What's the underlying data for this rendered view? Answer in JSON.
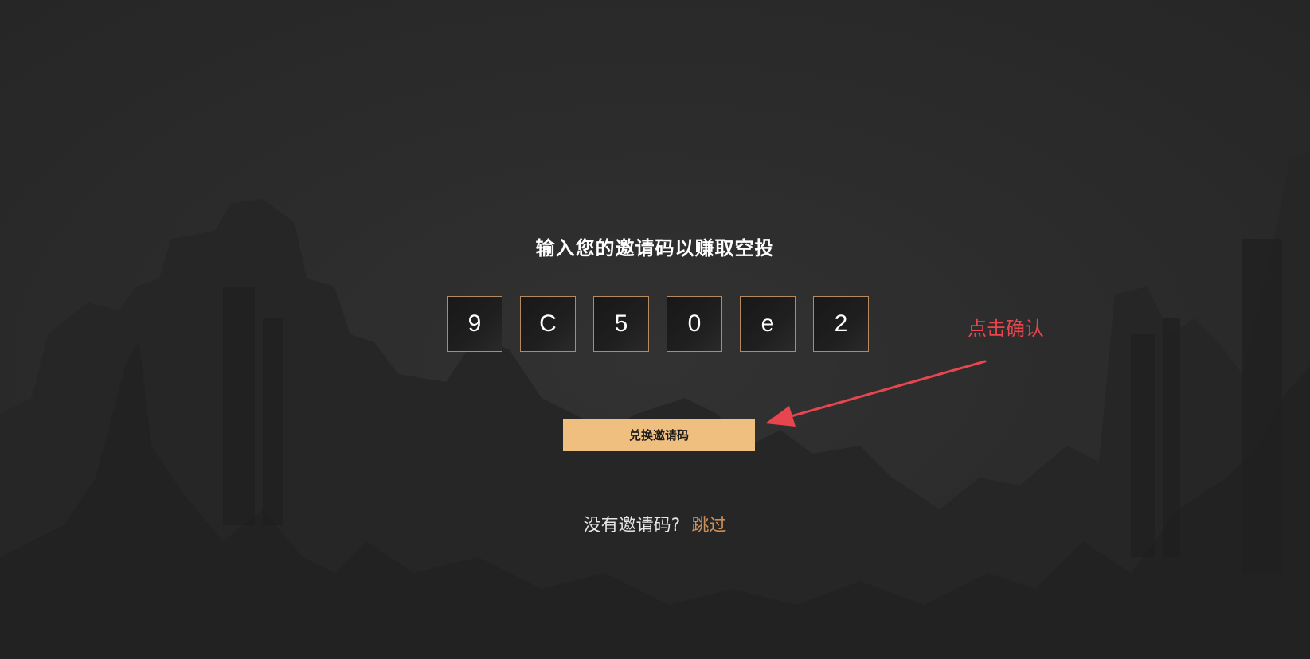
{
  "title": "输入您的邀请码以赚取空投",
  "code_digits": [
    "9",
    "C",
    "5",
    "0",
    "e",
    "2"
  ],
  "redeem_button": "兑换邀请码",
  "skip": {
    "question": "没有邀请码?",
    "link": "跳过"
  },
  "annotation": {
    "text": "点击确认",
    "color": "#e8454e"
  },
  "colors": {
    "accent_button": "#efbf80",
    "box_border": "#b48a5e",
    "skip_link": "#c98f5c",
    "background": "#2b2b2b"
  }
}
